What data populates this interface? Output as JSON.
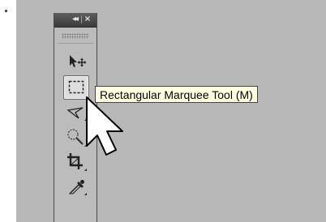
{
  "panel": {
    "collapse_glyph": "◂◂",
    "close_glyph": "×",
    "grip_icon": "grip-dots-icon"
  },
  "tools": [
    {
      "name": "Move Tool",
      "icon": "move-icon",
      "has_flyout": false
    },
    {
      "name": "Rectangular Marquee Tool",
      "icon": "rectangular-marquee-icon",
      "selected": true
    },
    {
      "name": "Lasso Tool",
      "icon": "lasso-icon",
      "has_flyout": true
    },
    {
      "name": "Quick Selection Tool",
      "icon": "quick-selection-icon",
      "has_flyout": true
    },
    {
      "name": "Crop Tool",
      "icon": "crop-icon",
      "has_flyout": true
    },
    {
      "name": "Eyedropper Tool",
      "icon": "eyedropper-icon",
      "has_flyout": true
    }
  ],
  "tooltip": {
    "text": "Rectangular Marquee Tool (M)"
  },
  "colors": {
    "backdrop": "#b8b8b8",
    "panel": "#bcbcbc",
    "titlebar": "#4a4a4a",
    "tooltip_bg": "#ffffe1"
  }
}
